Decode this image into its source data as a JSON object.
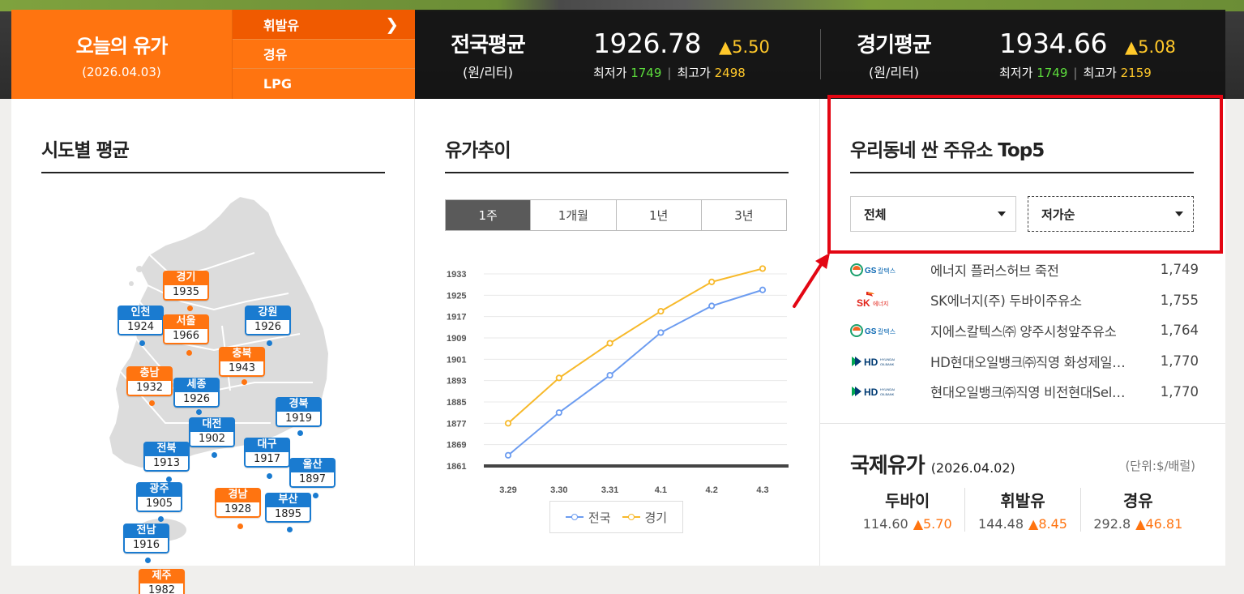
{
  "header": {
    "today_title": "오늘의 유가",
    "today_date": "(2026.04.03)",
    "fuel_menu": [
      {
        "label": "휘발유",
        "active": true
      },
      {
        "label": "경유",
        "active": false
      },
      {
        "label": "LPG",
        "active": false
      }
    ],
    "chevron_icon": "chevron-right-icon",
    "national": {
      "name": "전국평균",
      "unit": "(원/리터)",
      "price": "1926.78",
      "change": "▲5.50",
      "min_label": "최저가",
      "min": "1749",
      "max_label": "최고가",
      "max": "2498"
    },
    "gyeonggi": {
      "name": "경기평균",
      "unit": "(원/리터)",
      "price": "1934.66",
      "change": "▲5.08",
      "min_label": "최저가",
      "min": "1749",
      "max_label": "최고가",
      "max": "2159"
    }
  },
  "regional": {
    "title": "시도별 평균",
    "regions": [
      {
        "name": "경기",
        "value": "1935",
        "color": "orange"
      },
      {
        "name": "인천",
        "value": "1924",
        "color": "blue"
      },
      {
        "name": "서울",
        "value": "1966",
        "color": "orange"
      },
      {
        "name": "강원",
        "value": "1926",
        "color": "blue"
      },
      {
        "name": "충북",
        "value": "1943",
        "color": "orange"
      },
      {
        "name": "충남",
        "value": "1932",
        "color": "orange"
      },
      {
        "name": "세종",
        "value": "1926",
        "color": "blue"
      },
      {
        "name": "경북",
        "value": "1919",
        "color": "blue"
      },
      {
        "name": "대전",
        "value": "1902",
        "color": "blue"
      },
      {
        "name": "전북",
        "value": "1913",
        "color": "blue"
      },
      {
        "name": "대구",
        "value": "1917",
        "color": "blue"
      },
      {
        "name": "울산",
        "value": "1897",
        "color": "blue"
      },
      {
        "name": "광주",
        "value": "1905",
        "color": "blue"
      },
      {
        "name": "경남",
        "value": "1928",
        "color": "orange"
      },
      {
        "name": "부산",
        "value": "1895",
        "color": "blue"
      },
      {
        "name": "전남",
        "value": "1916",
        "color": "blue"
      },
      {
        "name": "제주",
        "value": "1982",
        "color": "orange"
      }
    ]
  },
  "trend": {
    "title": "유가추이",
    "tabs": [
      {
        "label": "1주",
        "active": true
      },
      {
        "label": "1개월",
        "active": false
      },
      {
        "label": "1년",
        "active": false
      },
      {
        "label": "3년",
        "active": false
      }
    ]
  },
  "chart_data": {
    "type": "line",
    "x": [
      "3.29",
      "3.30",
      "3.31",
      "4.1",
      "4.2",
      "4.3"
    ],
    "yticks": [
      1933,
      1925,
      1917,
      1909,
      1901,
      1893,
      1885,
      1877,
      1869,
      1861
    ],
    "ylim": [
      1861,
      1933
    ],
    "grid": true,
    "legend_position": "bottom",
    "series": [
      {
        "name": "전국",
        "color": "#6c9cf0",
        "values": [
          1865,
          1881,
          1895,
          1911,
          1921,
          1927
        ]
      },
      {
        "name": "경기",
        "color": "#f7b92a",
        "values": [
          1877,
          1894,
          1907,
          1919,
          1930,
          1935
        ]
      }
    ]
  },
  "top5": {
    "title": "우리동네 싼 주유소 Top5",
    "region_select": "전체",
    "sort_select": "저가순",
    "stations": [
      {
        "brand": "GS칼텍스",
        "brand_icon": "gs-caltex-logo-icon",
        "name": "에너지 플러스허브 죽전",
        "price": "1,749"
      },
      {
        "brand": "SK에너지",
        "brand_icon": "sk-energy-logo-icon",
        "name": "SK에너지(주) 두바이주유소",
        "price": "1,755"
      },
      {
        "brand": "GS칼텍스",
        "brand_icon": "gs-caltex-logo-icon",
        "name": "지에스칼텍스㈜ 양주시청앞주유소",
        "price": "1,764"
      },
      {
        "brand": "HD HYUNDAI OILBANK",
        "brand_icon": "hd-hyundai-oilbank-logo-icon",
        "name": "HD현대오일뱅크㈜직영 화성제일…",
        "price": "1,770"
      },
      {
        "brand": "HD HYUNDAI OILBANK",
        "brand_icon": "hd-hyundai-oilbank-logo-icon",
        "name": "현대오일뱅크㈜직영 비전현대Sel…",
        "price": "1,770"
      }
    ]
  },
  "international": {
    "title": "국제유가",
    "date": "(2026.04.02)",
    "unit": "(단위:$/배럴)",
    "items": [
      {
        "name": "두바이",
        "value": "114.60",
        "change": "▲5.70"
      },
      {
        "name": "휘발유",
        "value": "144.48",
        "change": "▲8.45"
      },
      {
        "name": "경유",
        "value": "292.8",
        "change": "▲46.81"
      }
    ]
  },
  "colors": {
    "accent_orange": "#ff7410",
    "region_blue": "#1a7bd0",
    "highlight_red": "#e30613",
    "up_yellow": "#ffc82a",
    "min_green": "#5cdc3c"
  }
}
